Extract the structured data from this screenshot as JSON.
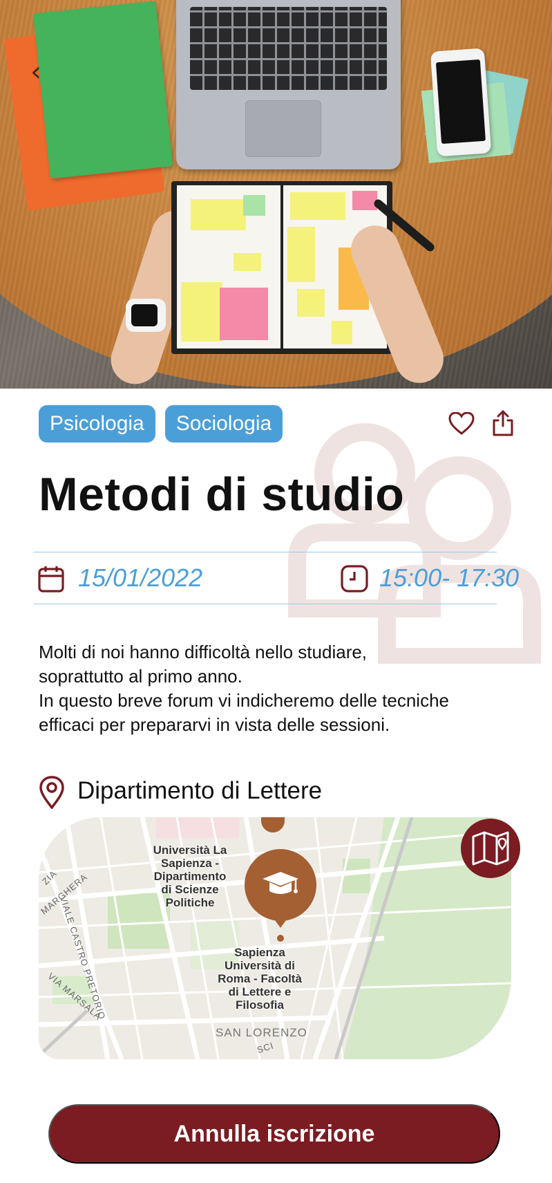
{
  "hero": {
    "image_alt": "study desk with laptop and planner"
  },
  "tags": [
    "Psicologia",
    "Sociologia"
  ],
  "event": {
    "title": "Metodi di studio",
    "date": "15/01/2022",
    "time": "15:00- 17:30",
    "description": [
      "Molti di noi hanno difficoltà nello studiare,",
      "soprattutto al primo anno.",
      "In questo breve forum vi indicheremo delle tecniche",
      "efficaci per prepararvi in vista delle sessioni."
    ],
    "location": "Dipartimento di Lettere"
  },
  "map": {
    "poi_1": [
      "Università La",
      "Sapienza -",
      "Dipartimento",
      "di Scienze",
      "Politiche"
    ],
    "poi_2": [
      "Sapienza",
      "Università di",
      "Roma - Facoltà",
      "di Lettere e",
      "Filosofia"
    ],
    "streets": {
      "viale_castro_pretorio": "VIALE CASTRO PRETORIO",
      "margherita": "MARGHERA",
      "via_marsala": "VIA MARSALA",
      "san_lorenzo": "SAN LORENZO",
      "zia": "ZIA",
      "sci": "SCI"
    }
  },
  "actions": {
    "cancel_label": "Annulla iscrizione"
  },
  "colors": {
    "accent_blue": "#4a9fd8",
    "brand_burgundy": "#7a1c22",
    "marker_brown": "#a45f33"
  },
  "icons": [
    "back-chevron-icon",
    "heart-icon",
    "share-icon",
    "calendar-icon",
    "clock-icon",
    "location-pin-icon",
    "map-icon",
    "graduation-cap-icon"
  ]
}
